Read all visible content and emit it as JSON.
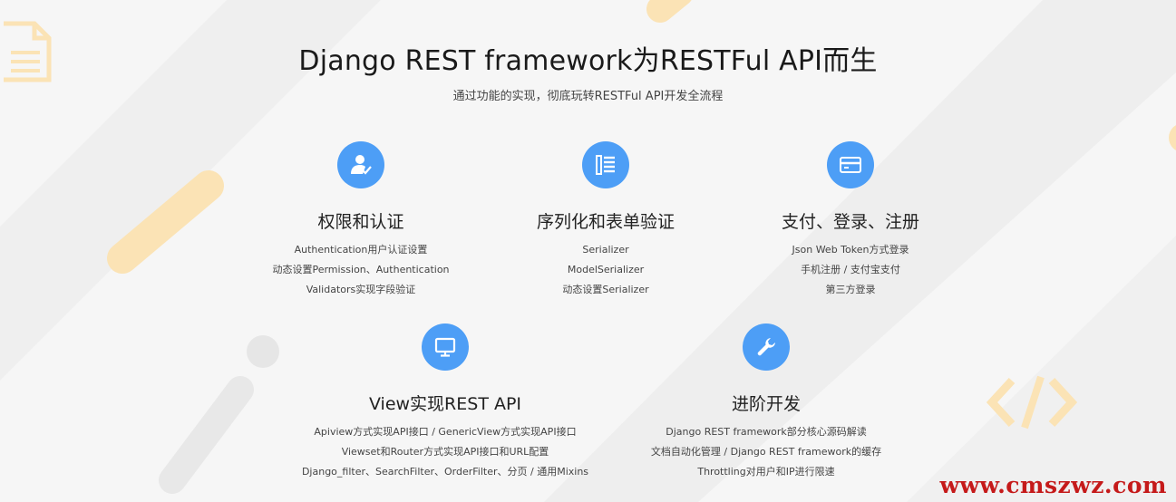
{
  "hero": {
    "title": "Django REST framework为RESTFul API而生",
    "subtitle": "通过功能的实现，彻底玩转RESTFul API开发全流程"
  },
  "features": [
    {
      "icon": "user-check-icon",
      "title": "权限和认证",
      "items": [
        "Authentication用户认证设置",
        "动态设置Permission、Authentication",
        "Validators实现字段验证"
      ]
    },
    {
      "icon": "list-icon",
      "title": "序列化和表单验证",
      "items": [
        "Serializer",
        "ModelSerializer",
        "动态设置Serializer"
      ]
    },
    {
      "icon": "card-icon",
      "title": "支付、登录、注册",
      "items": [
        "Json Web Token方式登录",
        "手机注册 / 支付宝支付",
        "第三方登录"
      ]
    },
    {
      "icon": "monitor-icon",
      "title": "View实现REST API",
      "items": [
        "Apiview方式实现API接口 / GenericView方式实现API接口",
        "Viewset和Router方式实现API接口和URL配置",
        "Django_filter、SearchFilter、OrderFilter、分页 / 通用Mixins"
      ]
    },
    {
      "icon": "wrench-icon",
      "title": "进阶开发",
      "items": [
        "Django REST framework部分核心源码解读",
        "文档自动化管理 / Django REST framework的缓存",
        "Throttling对用户和IP进行限速"
      ]
    }
  ],
  "watermark": "www.cmszwz.com",
  "colors": {
    "accent": "#4d9ef6",
    "decor_orange": "#fbe3b5",
    "decor_gray": "#ececec",
    "watermark": "#c51a1a"
  }
}
